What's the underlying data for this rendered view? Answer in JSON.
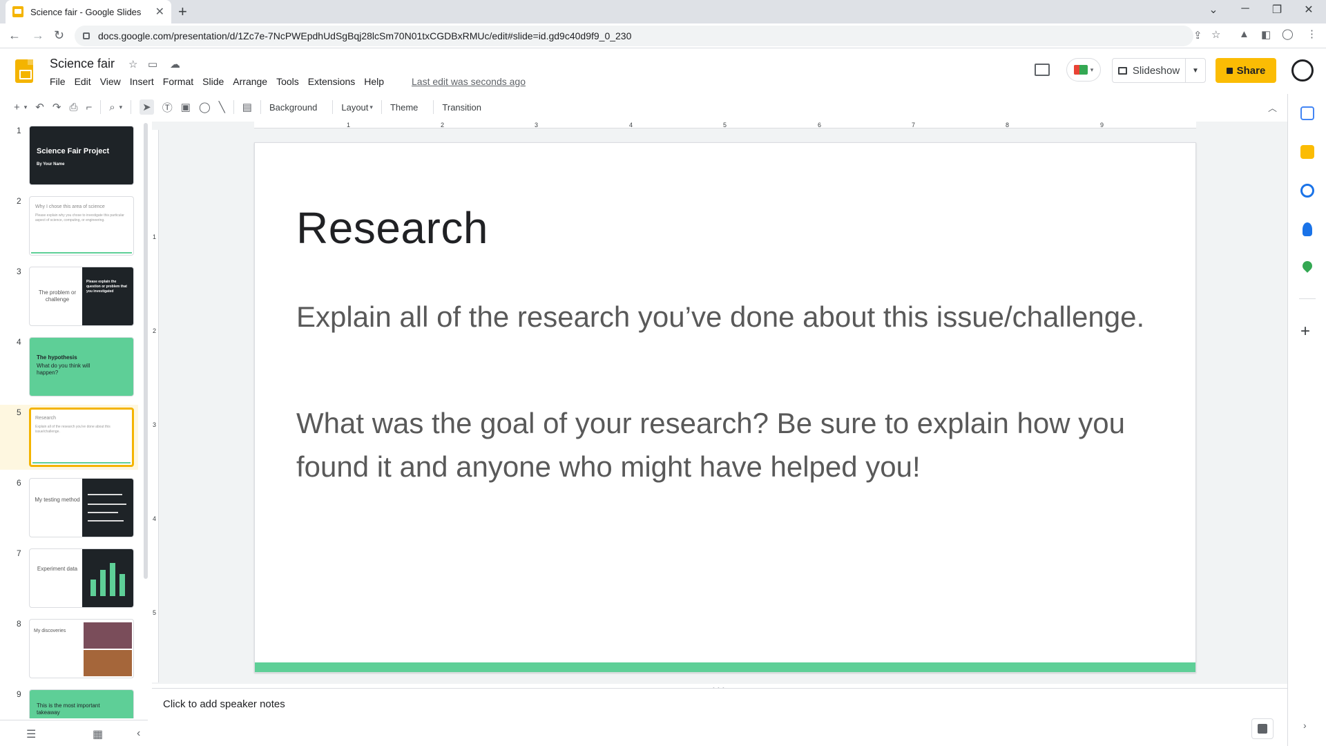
{
  "browser": {
    "tab_title": "Science fair - Google Slides",
    "tab_close": "✕",
    "new_tab": "+",
    "url": "docs.google.com/presentation/d/1Zc7e-7NcPWEpdhUdSgBqj28lcSm70N01txCGDBxRMUc/edit#slide=id.gd9c40d9f9_0_230",
    "window_controls": [
      "⌄",
      "─",
      "❐",
      "✕"
    ],
    "nav": {
      "back": "←",
      "forward": "→",
      "reload": "↻"
    }
  },
  "header": {
    "doc_title": "Science fair",
    "menu": [
      "File",
      "Edit",
      "View",
      "Insert",
      "Format",
      "Slide",
      "Arrange",
      "Tools",
      "Extensions",
      "Help"
    ],
    "last_edit": "Last edit was seconds ago",
    "slideshow_label": "Slideshow",
    "share_label": "Share",
    "brand_color": "#f4b400",
    "share_color": "#fbbc04"
  },
  "toolbar": {
    "background_label": "Background",
    "layout_label": "Layout",
    "theme_label": "Theme",
    "transition_label": "Transition",
    "icons": [
      "plus-icon",
      "undo-icon",
      "redo-icon",
      "print-icon",
      "paint-format-icon",
      "zoom-icon",
      "select-icon",
      "textbox-icon",
      "image-icon",
      "shape-icon",
      "line-icon",
      "comment-add-icon"
    ]
  },
  "filmstrip": {
    "slides": [
      {
        "num": "1",
        "title": "Science Fair Project",
        "sub": "By Your Name",
        "style": "dark"
      },
      {
        "num": "2",
        "title": "Why I chose this area of science",
        "sub": "Please explain why you chose to investigate this particular aspect of science, computing, or engineering.",
        "style": "light"
      },
      {
        "num": "3",
        "title": "The problem or challenge",
        "sub": "Please explain the question or problem that you investigated",
        "style": "split"
      },
      {
        "num": "4",
        "title": "The hypothesis",
        "sub": "What do you think will happen?",
        "style": "green"
      },
      {
        "num": "5",
        "title": "Research",
        "sub": "Explain all of the research you've done about this issue/challenge.",
        "style": "light-selected"
      },
      {
        "num": "6",
        "title": "My testing method",
        "sub": "",
        "style": "split"
      },
      {
        "num": "7",
        "title": "Experiment data",
        "sub": "",
        "style": "split-chart"
      },
      {
        "num": "8",
        "title": "My discoveries",
        "sub": "",
        "style": "photo"
      },
      {
        "num": "9",
        "title": "This is the most important takeaway",
        "sub": "",
        "style": "green"
      }
    ]
  },
  "ruler": {
    "h_numbers": [
      "1",
      "2",
      "3",
      "4",
      "5",
      "6",
      "7",
      "8",
      "9"
    ],
    "v_numbers": [
      "1",
      "2",
      "3",
      "4",
      "5"
    ]
  },
  "slide": {
    "title": "Research",
    "paragraph1": "Explain all of the research you’ve done about this issue/challenge.",
    "paragraph2": "What was the goal of your research? Be sure to explain how you found it and anyone who might have helped you!",
    "accent_color": "#5ecf97"
  },
  "notes": {
    "placeholder": "Click to add speaker notes"
  },
  "sidepanel": {
    "icons": [
      "calendar-icon",
      "keep-icon",
      "tasks-icon",
      "contacts-icon",
      "maps-icon"
    ],
    "add_label": "+"
  }
}
